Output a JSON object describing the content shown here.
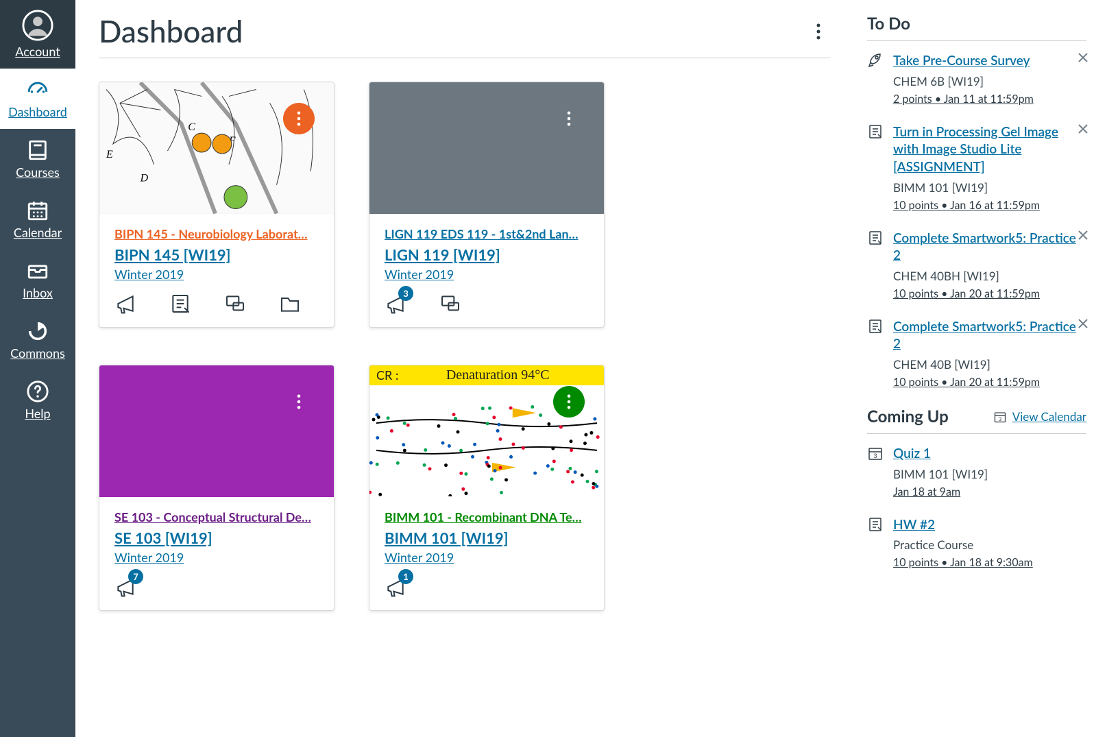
{
  "nav": {
    "items": [
      {
        "label": "Account"
      },
      {
        "label": "Dashboard"
      },
      {
        "label": "Courses"
      },
      {
        "label": "Calendar"
      },
      {
        "label": "Inbox"
      },
      {
        "label": "Commons"
      },
      {
        "label": "Help"
      }
    ]
  },
  "header": {
    "title": "Dashboard"
  },
  "cards": [
    {
      "title": "BIPN 145 - Neurobiology Laborat…",
      "code": "BIPN 145 [WI19]",
      "term": "Winter 2019",
      "title_color": "orange",
      "hero": "neurons",
      "fab": "orange",
      "actions": [
        "announcements",
        "assignments",
        "discussions",
        "files"
      ],
      "badges": {}
    },
    {
      "title": "LIGN 119 EDS 119 - 1st&2nd Lan…",
      "code": "LIGN 119 [WI19]",
      "term": "Winter 2019",
      "title_color": "blue",
      "hero": "grey",
      "fab": "grey",
      "actions": [
        "announcements",
        "discussions"
      ],
      "badges": {
        "announcements": "3"
      }
    },
    {
      "title": "SE 103 - Conceptual Structural De…",
      "code": "SE 103 [WI19]",
      "term": "Winter 2019",
      "title_color": "purple",
      "hero": "purple",
      "fab": "grey",
      "actions": [
        "announcements"
      ],
      "badges": {
        "announcements": "7"
      }
    },
    {
      "title": "BIMM 101 - Recombinant DNA Te…",
      "code": "BIMM 101 [WI19]",
      "term": "Winter 2019",
      "title_color": "green",
      "hero": "dna",
      "fab": "green",
      "actions": [
        "announcements"
      ],
      "badges": {
        "announcements": "1"
      },
      "dna_banner": {
        "left": "CR :",
        "center": "Denaturation 94°C"
      }
    }
  ],
  "todo_heading": "To Do",
  "todo": [
    {
      "icon": "rocket",
      "title": "Take Pre-Course Survey",
      "course": "CHEM 6B [WI19]",
      "meta": "2 points • Jan 11 at 11:59pm"
    },
    {
      "icon": "assignment",
      "title": "Turn in Processing Gel Image with Image Studio Lite [ASSIGNMENT]",
      "course": "BIMM 101 [WI19]",
      "meta": "10 points • Jan 16 at 11:59pm"
    },
    {
      "icon": "assignment",
      "title": "Complete Smartwork5: Practice 2",
      "course": "CHEM 40BH [WI19]",
      "meta": "10 points • Jan 20 at 11:59pm"
    },
    {
      "icon": "assignment",
      "title": "Complete Smartwork5: Practice 2",
      "course": "CHEM 40B [WI19]",
      "meta": "10 points • Jan 20 at 11:59pm"
    }
  ],
  "coming_heading": "Coming Up",
  "view_calendar_label": "View Calendar",
  "coming": [
    {
      "icon": "calendar",
      "title": "Quiz 1",
      "course": "BIMM 101 [WI19]",
      "meta": "Jan 18 at 9am"
    },
    {
      "icon": "assignment",
      "title": "HW #2",
      "course": "Practice Course",
      "meta": "10 points • Jan 18 at 9:30am"
    }
  ]
}
